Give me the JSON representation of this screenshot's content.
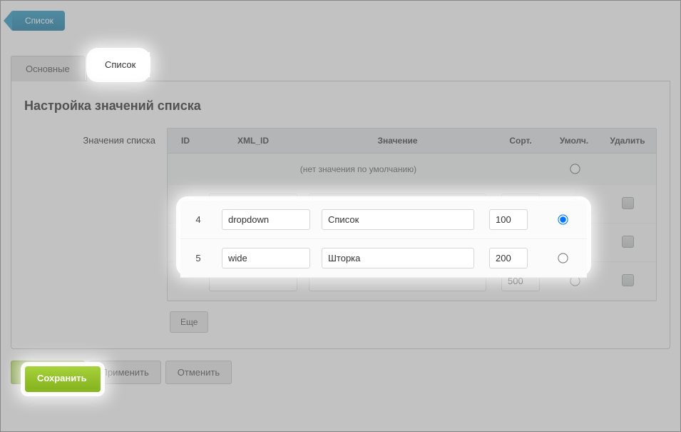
{
  "back_button": "Список",
  "tabs": {
    "main": "Основные",
    "list": "Список"
  },
  "page_title": "Настройка значений списка",
  "side_label": "Значения списка",
  "headers": {
    "id": "ID",
    "xml": "XML_ID",
    "value": "Значение",
    "sort": "Сорт.",
    "default": "Умолч.",
    "delete": "Удалить"
  },
  "no_default_text": "(нет значения по умолчанию)",
  "rows": [
    {
      "id": "4",
      "xml": "dropdown",
      "value": "Список",
      "sort": "100",
      "default": true
    },
    {
      "id": "5",
      "xml": "wide",
      "value": "Шторка",
      "sort": "200",
      "default": false
    }
  ],
  "new_row": {
    "sort": "500"
  },
  "more_button": "Еще",
  "actions": {
    "save": "Сохранить",
    "apply": "Применить",
    "cancel": "Отменить"
  }
}
